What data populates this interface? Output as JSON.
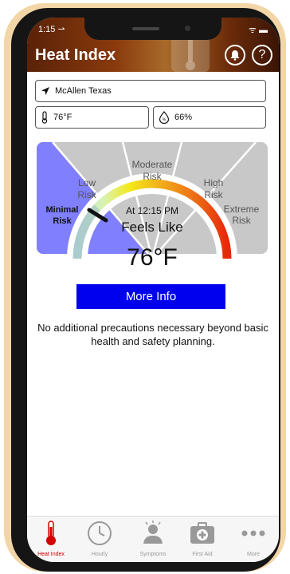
{
  "status": {
    "time": "1:15 ⇀",
    "right": "ᯤ ▬"
  },
  "header": {
    "title": "Heat Index",
    "notify_icon": "bell-icon",
    "help_icon": "question-icon"
  },
  "location": {
    "value": "McAllen Texas"
  },
  "temperature": {
    "value": "76°F"
  },
  "humidity": {
    "value": "66%"
  },
  "gauge": {
    "zones": {
      "minimal": {
        "line1": "Minimal",
        "line2": "Risk"
      },
      "low": {
        "line1": "Low",
        "line2": "Risk"
      },
      "moderate": {
        "line1": "Moderate",
        "line2": "Risk"
      },
      "high": {
        "line1": "High",
        "line2": "Risk"
      },
      "extreme": {
        "line1": "Extreme",
        "line2": "Risk"
      }
    },
    "time_label": "At 12:15 PM",
    "feels_like_label": "Feels Like",
    "feels_like_value": "76°F",
    "colors": {
      "minimal": "#8080ff",
      "zone_gray": "#c8c8c8",
      "arc_yellow": "#f4e81a",
      "arc_red": "#e8280a"
    }
  },
  "more_info_label": "More Info",
  "description": "No additional precautions necessary beyond basic health and safety planning.",
  "tabs": [
    {
      "label": "Heat Index",
      "icon": "thermometer-icon",
      "active": true
    },
    {
      "label": "Hourly",
      "icon": "clock-icon",
      "active": false
    },
    {
      "label": "Symptoms",
      "icon": "person-sweat-icon",
      "active": false
    },
    {
      "label": "First Aid",
      "icon": "first-aid-icon",
      "active": false
    },
    {
      "label": "More",
      "icon": "more-dots-icon",
      "active": false
    }
  ]
}
